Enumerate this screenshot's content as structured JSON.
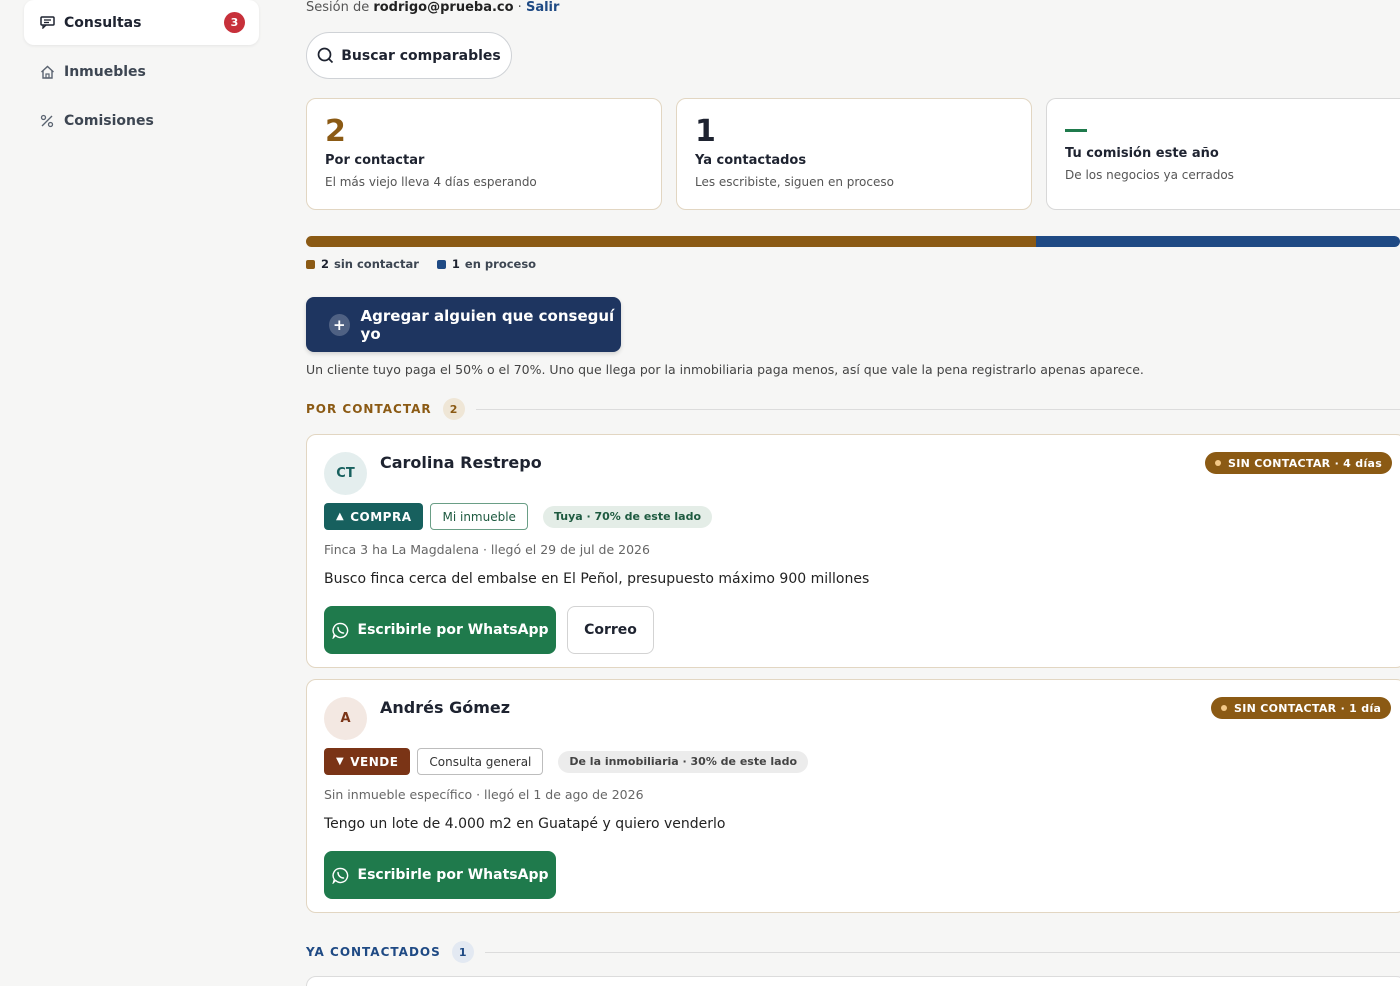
{
  "sidebar": {
    "items": [
      {
        "label": "Consultas",
        "icon": "chat-icon",
        "badge": "3",
        "active": true
      },
      {
        "label": "Inmuebles",
        "icon": "home-icon"
      },
      {
        "label": "Comisiones",
        "icon": "percent-icon"
      }
    ]
  },
  "header": {
    "session_prefix": "Sesión de ",
    "session_email": "rodrigo@prueba.co",
    "session_sep": " · ",
    "logout_label": "Salir",
    "search_label": "Buscar comparables"
  },
  "stats": [
    {
      "value": "2",
      "title": "Por contactar",
      "subtitle": "El más viejo lleva 4 días esperando",
      "color": "#8b5a14"
    },
    {
      "value": "1",
      "title": "Ya contactados",
      "subtitle": "Les escribiste, siguen en proceso",
      "color": "#1e2330"
    },
    {
      "value": "—",
      "title": "Tu comisión este año",
      "subtitle": "De los negocios ya cerrados",
      "color": "#1f7a4c"
    }
  ],
  "progress": {
    "segments": [
      {
        "count": "2",
        "label": "sin contactar",
        "fraction": 0.667,
        "color": "#8b5a14"
      },
      {
        "count": "1",
        "label": "en proceso",
        "fraction": 0.333,
        "color": "#1f4a84"
      }
    ]
  },
  "add_button": {
    "label": "Agregar alguien que conseguí yo",
    "icon": "plus-icon"
  },
  "hint": "Un cliente tuyo paga el 50% o el 70%. Uno que llega por la inmobiliaria paga menos, así que vale la pena registrarlo apenas aparece.",
  "sections": {
    "pending": {
      "label": "POR CONTACTAR",
      "count": "2",
      "color": "#8b5a14"
    },
    "contacted": {
      "label": "YA CONTACTADOS",
      "count": "1",
      "color": "#1f4a84"
    }
  },
  "leads": [
    {
      "initials": "CT",
      "name": "Carolina Restrepo",
      "status": "SIN CONTACTAR · 4 días",
      "type": "COMPRA",
      "type_icon": "triangle-up-icon",
      "type_color": "#17605e",
      "origin": "Mi inmueble",
      "share": "Tuya · 70% de este lado",
      "meta": "Finca 3 ha La Magdalena · llegó el 29 de jul de 2026",
      "message": "Busco finca cerca del embalse en El Peñol, presupuesto máximo 900 millones",
      "whatsapp_label": "Escribirle por WhatsApp",
      "email_label": "Correo"
    },
    {
      "initials": "A",
      "name": "Andrés Gómez",
      "status": "SIN CONTACTAR · 1 día",
      "type": "VENDE",
      "type_icon": "triangle-down-icon",
      "type_color": "#7a3416",
      "origin": "Consulta general",
      "share": "De la inmobiliaria · 30% de este lado",
      "meta": "Sin inmueble específico · llegó el 1 de ago de 2026",
      "message": "Tengo un lote de 4.000 m2 en Guatapé y quiero venderlo",
      "whatsapp_label": "Escribirle por WhatsApp"
    }
  ]
}
